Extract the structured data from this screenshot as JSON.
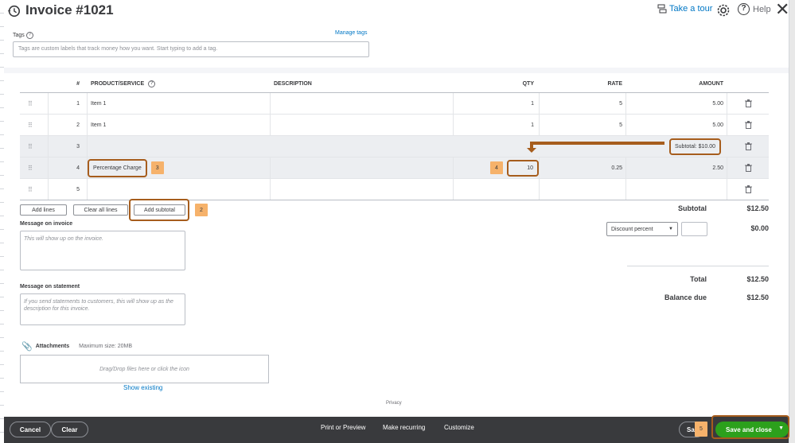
{
  "header": {
    "title": "Invoice #1021",
    "take_tour": "Take a tour",
    "help": "Help"
  },
  "tags": {
    "label": "Tags",
    "manage": "Manage tags",
    "placeholder": "Tags are custom labels that track money how you want. Start typing to add a tag."
  },
  "table": {
    "headers": {
      "num": "#",
      "product": "PRODUCT/SERVICE",
      "description": "DESCRIPTION",
      "qty": "QTY",
      "rate": "RATE",
      "amount": "AMOUNT"
    },
    "rows": [
      {
        "num": "1",
        "product": "Item 1",
        "description": "",
        "qty": "1",
        "rate": "5",
        "amount": "5.00"
      },
      {
        "num": "2",
        "product": "Item 1",
        "description": "",
        "qty": "1",
        "rate": "5",
        "amount": "5.00"
      },
      {
        "num": "3",
        "product": "",
        "description": "",
        "qty": "",
        "rate": "",
        "amount": "Subtotal: $10.00"
      },
      {
        "num": "4",
        "product": "Percentage Charge",
        "description": "",
        "qty": "10",
        "rate": "0.25",
        "amount": "2.50"
      },
      {
        "num": "5",
        "product": "",
        "description": "",
        "qty": "",
        "rate": "",
        "amount": ""
      }
    ]
  },
  "badges": {
    "b2": "2",
    "b3": "3",
    "b4": "4",
    "b5": "5"
  },
  "actions": {
    "add_lines": "Add lines",
    "clear_all": "Clear all lines",
    "add_subtotal": "Add subtotal"
  },
  "message_invoice": {
    "label": "Message on invoice",
    "placeholder": "This will show up on the invoice."
  },
  "message_statement": {
    "label": "Message on statement",
    "placeholder": "If you send statements to customers, this will show up as the description for this invoice."
  },
  "attachments": {
    "label": "Attachments",
    "max_size": "Maximum size: 20MB",
    "drop": "Drag/Drop files here or click the icon",
    "show_existing": "Show existing"
  },
  "totals": {
    "subtotal_label": "Subtotal",
    "subtotal_value": "$12.50",
    "discount_select": "Discount percent",
    "discount_value": "$0.00",
    "total_label": "Total",
    "total_value": "$12.50",
    "balance_label": "Balance due",
    "balance_value": "$12.50"
  },
  "privacy": "Privacy",
  "footer": {
    "cancel": "Cancel",
    "clear": "Clear",
    "print_preview": "Print or Preview",
    "make_recurring": "Make recurring",
    "customize": "Customize",
    "save_partial": "Sa",
    "save_close": "Save and close"
  },
  "colors": {
    "accent_green": "#2ca01c",
    "callout_brown": "#a65d1d",
    "badge_orange": "#f6b26b",
    "link_blue": "#0077c5",
    "footer_bg": "#393a3d"
  }
}
